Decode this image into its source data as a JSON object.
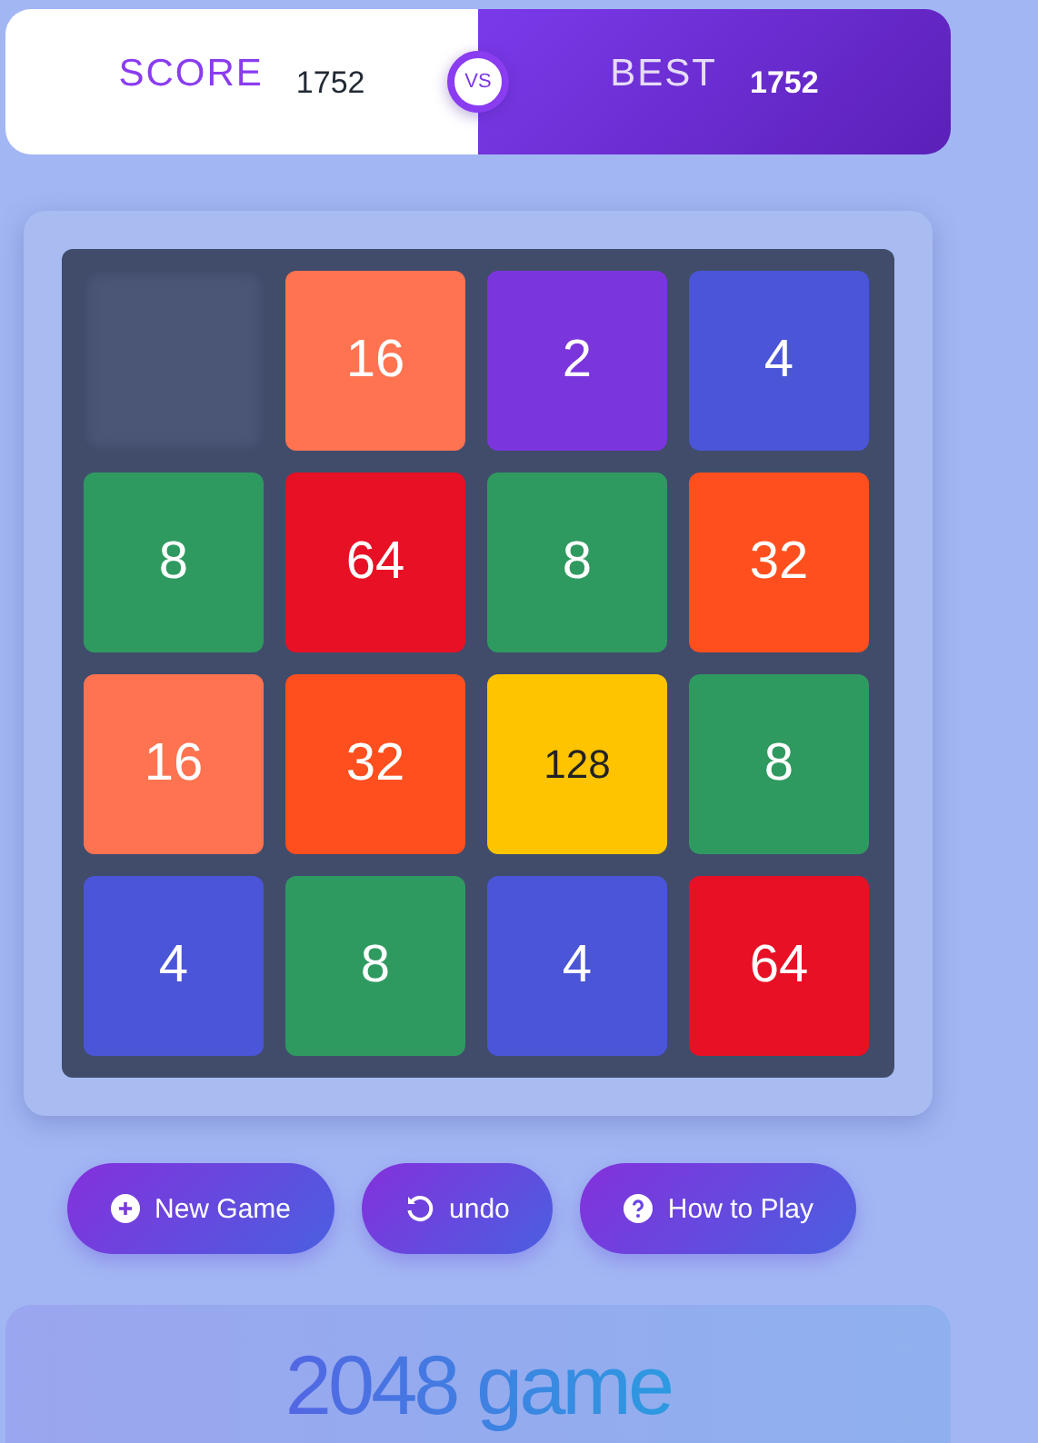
{
  "scoreboard": {
    "score_label": "SCORE",
    "score": "1752",
    "versus": "VS",
    "best_label": "BEST",
    "best": "1752"
  },
  "board": {
    "tiles": [
      {
        "kind": "empty"
      },
      {
        "kind": "light",
        "value": "16",
        "color": "#ff7350"
      },
      {
        "kind": "light",
        "value": "2",
        "color": "#7a35dc"
      },
      {
        "kind": "light",
        "value": "4",
        "color": "#4a55d8"
      },
      {
        "kind": "light",
        "value": "8",
        "color": "#2f9a60"
      },
      {
        "kind": "light",
        "value": "64",
        "color": "#e81024"
      },
      {
        "kind": "light",
        "value": "8",
        "color": "#2f9a60"
      },
      {
        "kind": "light",
        "value": "32",
        "color": "#ff4f1e"
      },
      {
        "kind": "light",
        "value": "16",
        "color": "#ff7350"
      },
      {
        "kind": "light",
        "value": "32",
        "color": "#ff4f1e"
      },
      {
        "kind": "dark",
        "value": "128",
        "color": "#ffc400"
      },
      {
        "kind": "light",
        "value": "8",
        "color": "#2f9a60"
      },
      {
        "kind": "light",
        "value": "4",
        "color": "#4a55d8"
      },
      {
        "kind": "light",
        "value": "8",
        "color": "#2f9a60"
      },
      {
        "kind": "light",
        "value": "4",
        "color": "#4a55d8"
      },
      {
        "kind": "light",
        "value": "64",
        "color": "#e81024"
      }
    ]
  },
  "buttons": [
    {
      "kind": "new",
      "label": "New Game"
    },
    {
      "kind": "undo",
      "label": "undo"
    },
    {
      "kind": "help",
      "label": "How to Play"
    }
  ],
  "title": "2048 game"
}
